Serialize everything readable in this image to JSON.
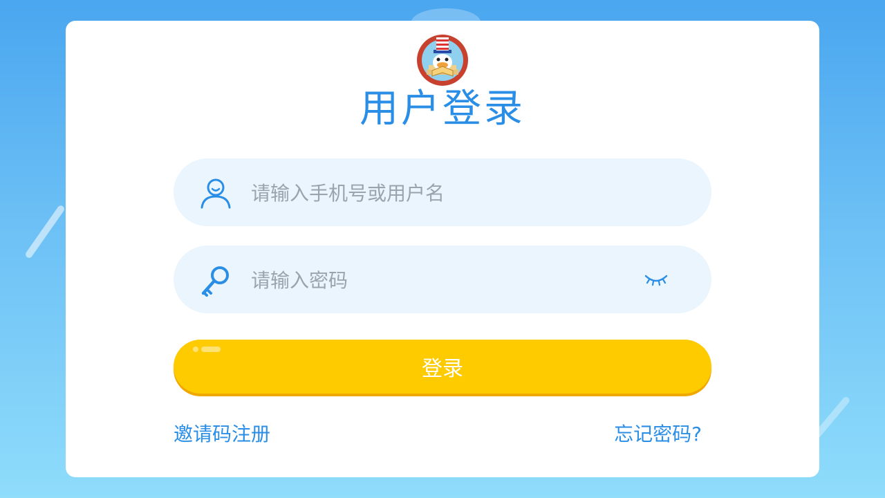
{
  "page": {
    "title": "用户登录",
    "logo_icon": "duck-reading-mascot-logo"
  },
  "form": {
    "username": {
      "placeholder": "请输入手机号或用户名",
      "value": "",
      "icon": "user-icon"
    },
    "password": {
      "placeholder": "请输入密码",
      "value": "",
      "icon": "key-icon",
      "toggle_icon": "eye-closed-icon"
    },
    "submit_label": "登录"
  },
  "links": {
    "register": "邀请码注册",
    "forgot": "忘记密码?"
  },
  "colors": {
    "accent": "#2a8ee6",
    "button": "#fdcb00",
    "field_bg": "#eaf5fd",
    "background_top": "#4aa6ef",
    "background_bottom": "#8fdcfb"
  }
}
